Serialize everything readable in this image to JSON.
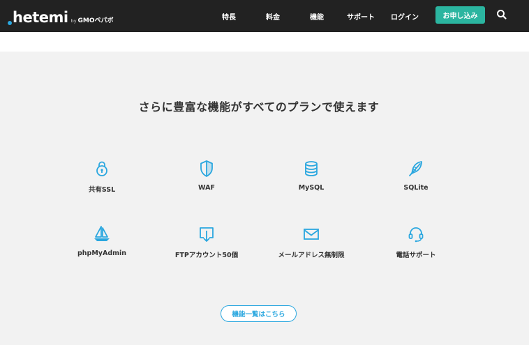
{
  "logo": {
    "mark": "hetemi",
    "by": "by",
    "company": "GMOペパボ"
  },
  "nav": {
    "items": [
      "特長",
      "料金",
      "機能",
      "サポート",
      "ログイン"
    ],
    "apply_label": "お申し込み",
    "search_icon": "search-icon"
  },
  "section": {
    "title": "さらに豊富な機能がすべてのプランで使えます",
    "features": [
      {
        "label": "共有SSL",
        "icon": "lock-icon"
      },
      {
        "label": "WAF",
        "icon": "shield-icon"
      },
      {
        "label": "MySQL",
        "icon": "database-icon"
      },
      {
        "label": "SQLite",
        "icon": "feather-icon"
      },
      {
        "label": "phpMyAdmin",
        "icon": "sailboat-icon"
      },
      {
        "label": "FTPアカウント50個",
        "icon": "download-box-icon"
      },
      {
        "label": "メールアドレス無制限",
        "icon": "mail-icon"
      },
      {
        "label": "電話サポート",
        "icon": "headset-icon"
      }
    ],
    "more_label": "機能一覧はこちら"
  },
  "colors": {
    "accent": "#2aa7df",
    "apply": "#2bb5a0",
    "header": "#222222",
    "background": "#f2f2f2"
  }
}
